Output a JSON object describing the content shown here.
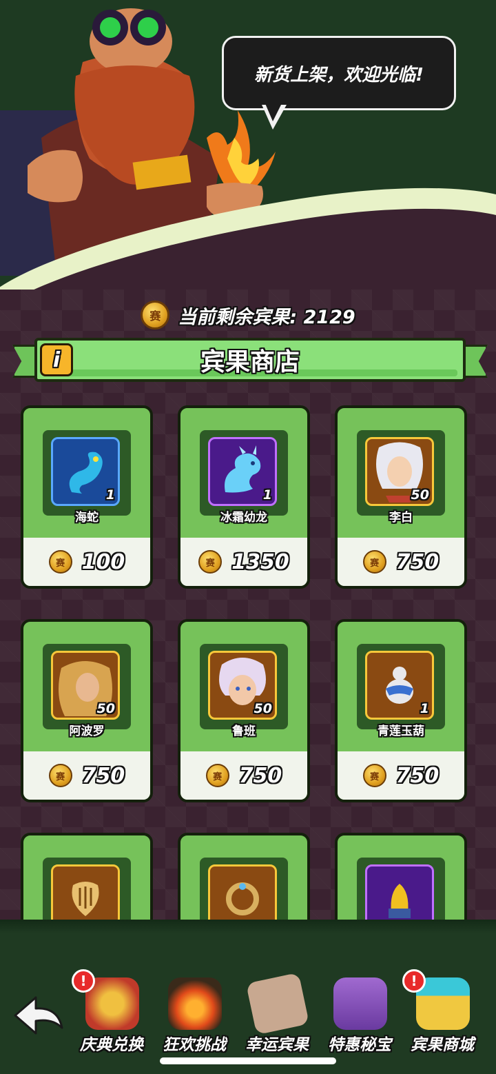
{
  "header": {
    "speech_bubble": "新货上架，欢迎光临!"
  },
  "shop": {
    "balance_label": "当前剩余宾果: 2129",
    "title": "宾果商店",
    "info_icon": "i"
  },
  "items": [
    {
      "name": "海蛇",
      "count": "1",
      "price": "100",
      "rarity": "blue",
      "icon": "sea-serpent-icon"
    },
    {
      "name": "冰霜幼龙",
      "count": "1",
      "price": "1350",
      "rarity": "purple",
      "icon": "frost-dragon-icon"
    },
    {
      "name": "李白",
      "count": "50",
      "price": "750",
      "rarity": "gold",
      "icon": "li-bai-portrait"
    },
    {
      "name": "阿波罗",
      "count": "50",
      "price": "750",
      "rarity": "gold",
      "icon": "apollo-portrait"
    },
    {
      "name": "鲁班",
      "count": "50",
      "price": "750",
      "rarity": "gold",
      "icon": "lu-ban-portrait"
    },
    {
      "name": "青莲玉葫",
      "count": "1",
      "price": "750",
      "rarity": "gold",
      "icon": "gourd-icon"
    },
    {
      "name": "",
      "count": "",
      "price": "",
      "rarity": "gold",
      "icon": "lyre-icon"
    },
    {
      "name": "",
      "count": "",
      "price": "",
      "rarity": "gold",
      "icon": "ring-icon"
    },
    {
      "name": "",
      "count": "",
      "price": "",
      "rarity": "purple",
      "icon": "golden-mask-icon"
    }
  ],
  "nav": {
    "items": [
      {
        "label": "庆典兑换",
        "badge": "!",
        "icon": "medal-icon"
      },
      {
        "label": "狂欢挑战",
        "badge": "",
        "icon": "campfire-icon"
      },
      {
        "label": "幸运宾果",
        "badge": "",
        "icon": "dice-icon"
      },
      {
        "label": "特惠秘宝",
        "badge": "",
        "icon": "treasure-gift-icon"
      },
      {
        "label": "宾果商城",
        "badge": "!",
        "icon": "shop-stall-icon"
      }
    ]
  },
  "colors": {
    "card_green": "#76c25a",
    "banner_green": "#8be07a",
    "background_maroon": "#3a2230",
    "nav_green": "#1f3a22"
  }
}
